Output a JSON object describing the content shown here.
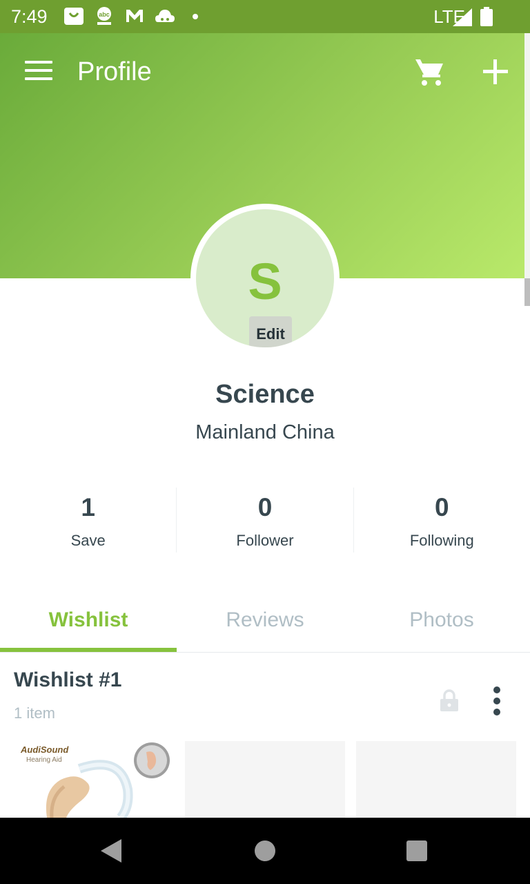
{
  "status_bar": {
    "time": "7:49",
    "network": "LTE",
    "icons": [
      "shopping-bag-icon",
      "abc-news-icon",
      "gmail-icon",
      "cloud-icon",
      "dot-icon"
    ]
  },
  "header": {
    "title": "Profile",
    "icons": [
      "menu-icon",
      "cart-icon",
      "add-icon"
    ],
    "gradient_colors": [
      "#6aab3a",
      "#b9e96a"
    ]
  },
  "profile": {
    "avatar_letter": "S",
    "edit_label": "Edit",
    "name": "Science",
    "location": "Mainland China"
  },
  "stats": [
    {
      "count": "1",
      "label": "Save"
    },
    {
      "count": "0",
      "label": "Follower"
    },
    {
      "count": "0",
      "label": "Following"
    }
  ],
  "tabs": [
    {
      "label": "Wishlist",
      "active": true
    },
    {
      "label": "Reviews",
      "active": false
    },
    {
      "label": "Photos",
      "active": false
    }
  ],
  "wishlist": {
    "title": "Wishlist #1",
    "count": "1 item",
    "thumb_brand": "AudiSound",
    "thumb_sub": "Hearing Aid"
  },
  "colors": {
    "accent": "#86c23d",
    "status_bar": "#6f9f30",
    "text": "#37474f",
    "muted": "#b0bec5"
  }
}
